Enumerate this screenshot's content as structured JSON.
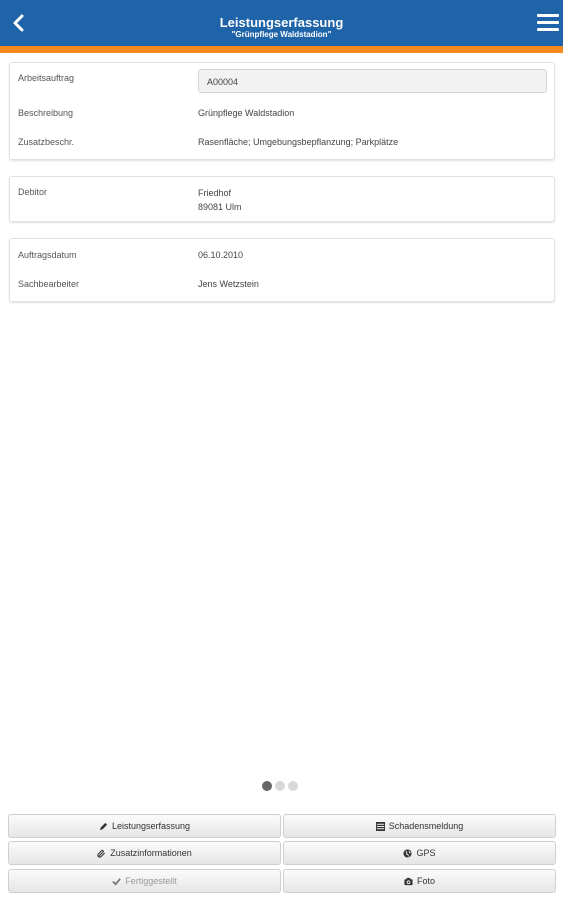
{
  "header": {
    "title": "Leistungserfassung",
    "subtitle": "\"Grünpflege Waldstadion\"",
    "back_icon": "chevron-left-icon",
    "menu_icon": "hamburger-menu-icon",
    "bar_color": "#1f63a8",
    "accent_color": "#f5891f"
  },
  "card1": {
    "order_label": "Arbeitsauftrag",
    "order_value": "A00004",
    "desc_label": "Beschreibung",
    "desc_value": "Grünpflege Waldstadion",
    "extra_label": "Zusatzbeschr.",
    "extra_value": "Rasenfläche; Umgebungsbepflanzung; Parkplätze"
  },
  "card2": {
    "debtor_label": "Debitor",
    "debtor_line1": "Friedhof",
    "debtor_line2": "89081 Ulm"
  },
  "card3": {
    "date_label": "Auftragsdatum",
    "date_value": "06.10.2010",
    "clerk_label": "Sachbearbeiter",
    "clerk_value": "Jens Wetzstein"
  },
  "pager": {
    "pages": 3,
    "active": 1
  },
  "buttons": {
    "leistungserfassung": "Leistungserfassung",
    "schadensmeldung": "Schadensmeldung",
    "zusatzinformationen": "Zusatzinformationen",
    "gps": "GPS",
    "fertiggestellt": "Fertiggestellt",
    "foto": "Foto"
  }
}
